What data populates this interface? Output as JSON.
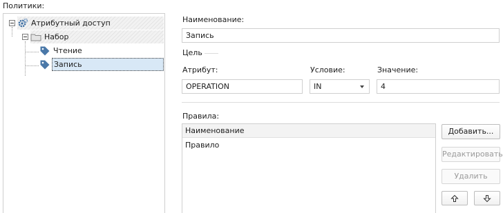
{
  "policies_label": "Политики:",
  "tree": {
    "root": {
      "label": "Атрибутный доступ",
      "icon": "gear-icon"
    },
    "group": {
      "label": "Набор",
      "icon": "folder-icon"
    },
    "items": [
      {
        "label": "Чтение",
        "icon": "tag-icon",
        "selected": false
      },
      {
        "label": "Запись",
        "icon": "tag-icon",
        "selected": true
      }
    ]
  },
  "details": {
    "name_label": "Наименование:",
    "name_value": "Запись",
    "target_section": "Цель",
    "attribute_label": "Атрибут:",
    "attribute_value": "OPERATION",
    "condition_label": "Условие:",
    "condition_value": "IN",
    "value_label": "Значение:",
    "value_value": "4",
    "rules_label": "Правила:",
    "rules_header": "Наименование",
    "rules": [
      "Правило"
    ]
  },
  "buttons": {
    "add": "Добавить...",
    "edit": "Редактировать",
    "delete": "Удалить"
  },
  "colors": {
    "selection": "#d8e8f6",
    "tag_icon": "#4a78a8",
    "gear_icon": "#3d6fa3",
    "folder_icon": "#c9c9c9"
  }
}
